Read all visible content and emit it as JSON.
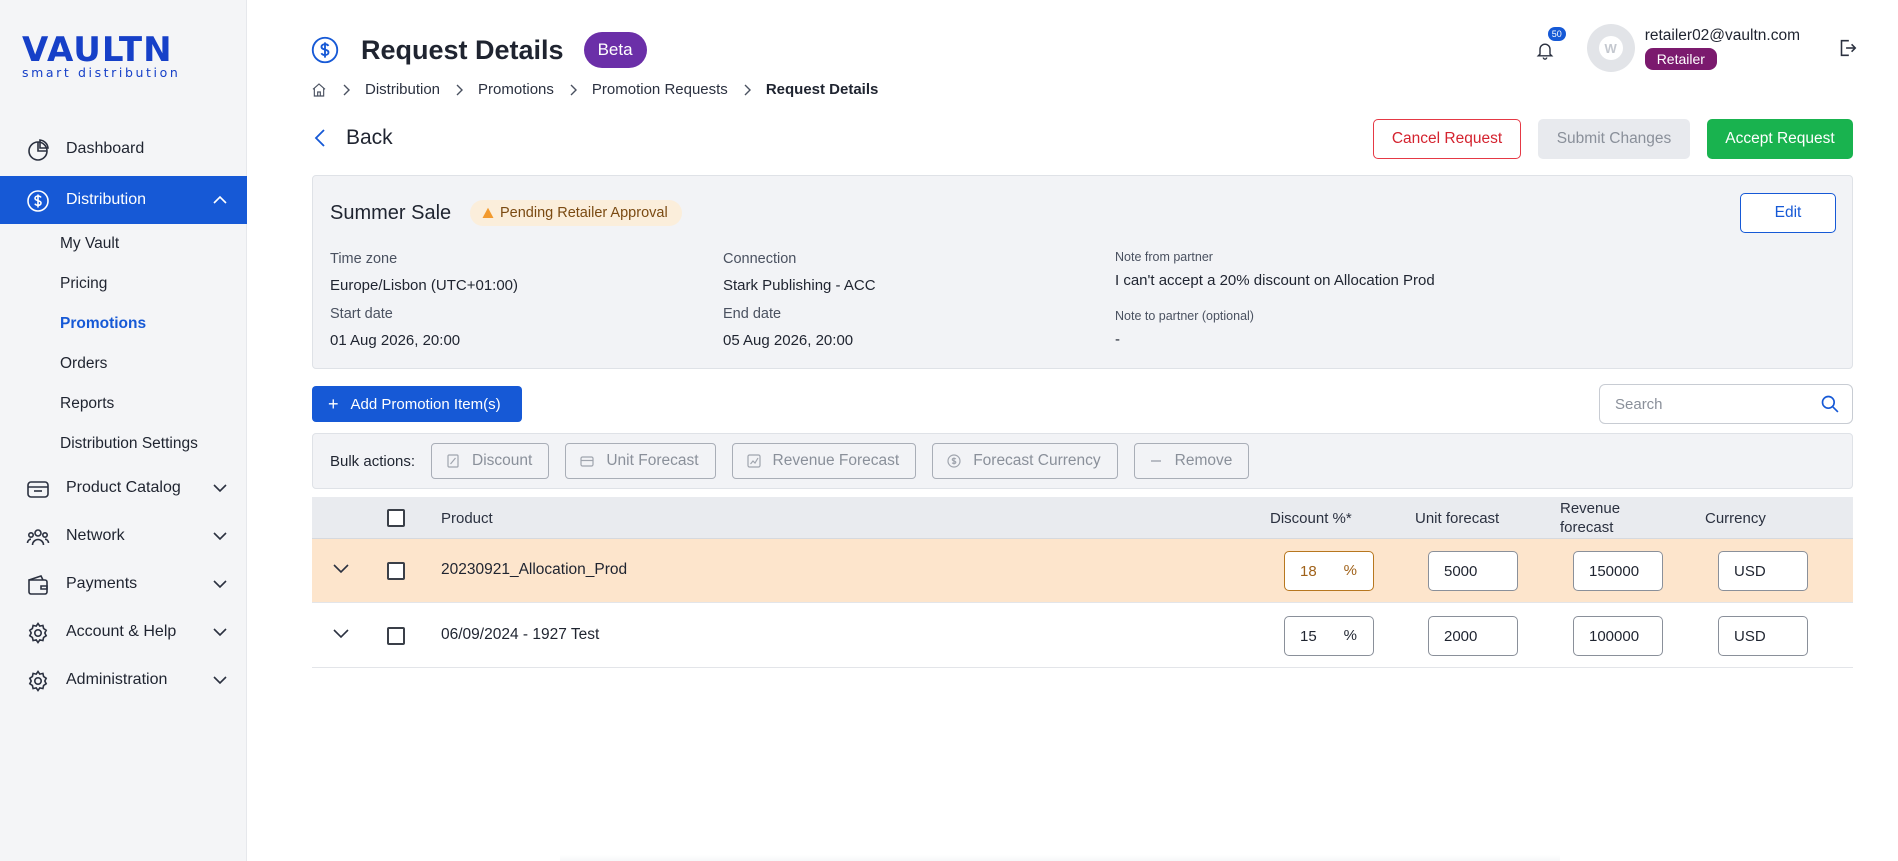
{
  "logo": {
    "main": "VAULTN",
    "sub": "smart distribution"
  },
  "sidebar": {
    "items": [
      {
        "label": "Dashboard",
        "icon": "dashboard-icon"
      },
      {
        "label": "Distribution",
        "icon": "dollar-circle-icon",
        "active": true,
        "children": [
          "My Vault",
          "Pricing",
          "Promotions",
          "Orders",
          "Reports",
          "Distribution Settings"
        ],
        "current_child": "Promotions"
      },
      {
        "label": "Product Catalog",
        "icon": "box-icon"
      },
      {
        "label": "Network",
        "icon": "network-icon"
      },
      {
        "label": "Payments",
        "icon": "wallet-icon"
      },
      {
        "label": "Account & Help",
        "icon": "gear-icon"
      },
      {
        "label": "Administration",
        "icon": "gear-icon"
      }
    ]
  },
  "header": {
    "title": "Request Details",
    "badge": "Beta",
    "notifications": "50",
    "user_email": "retailer02@vaultn.com",
    "user_role": "Retailer"
  },
  "breadcrumb": [
    "Distribution",
    "Promotions",
    "Promotion Requests",
    "Request Details"
  ],
  "actions": {
    "back": "Back",
    "cancel": "Cancel Request",
    "submit": "Submit Changes",
    "accept": "Accept Request"
  },
  "summary": {
    "name": "Summer Sale",
    "status": "Pending Retailer Approval",
    "edit": "Edit",
    "timezone_label": "Time zone",
    "timezone": "Europe/Lisbon (UTC+01:00)",
    "connection_label": "Connection",
    "connection": "Stark Publishing - ACC",
    "start_label": "Start date",
    "start": "01 Aug 2026, 20:00",
    "end_label": "End date",
    "end": "05 Aug 2026, 20:00",
    "note_from_label": "Note from partner",
    "note_from": "I can't accept a 20% discount on Allocation Prod",
    "note_to_label": "Note to partner (optional)",
    "note_to": "-"
  },
  "toolbar": {
    "add": "Add Promotion Item(s)",
    "search_placeholder": "Search",
    "bulk_label": "Bulk actions:",
    "bulk": [
      "Discount",
      "Unit Forecast",
      "Revenue Forecast",
      "Forecast Currency",
      "Remove"
    ]
  },
  "table": {
    "headers": {
      "product": "Product",
      "discount": "Discount %*",
      "unit": "Unit forecast",
      "revenue": "Revenue forecast",
      "currency": "Currency"
    },
    "rows": [
      {
        "product": "20230921_Allocation_Prod",
        "discount": "18",
        "unit": "5000",
        "revenue": "150000",
        "currency": "USD",
        "highlighted": true
      },
      {
        "product": "06/09/2024 - 1927 Test",
        "discount": "15",
        "unit": "2000",
        "revenue": "100000",
        "currency": "USD",
        "highlighted": false
      }
    ],
    "pct_symbol": "%"
  },
  "colors": {
    "brand": "#1659d6",
    "accept": "#19b34f",
    "cancel": "#e53945",
    "beta": "#6b2fa8",
    "role": "#7b1a6e",
    "highlight_row": "#fde5cc"
  }
}
